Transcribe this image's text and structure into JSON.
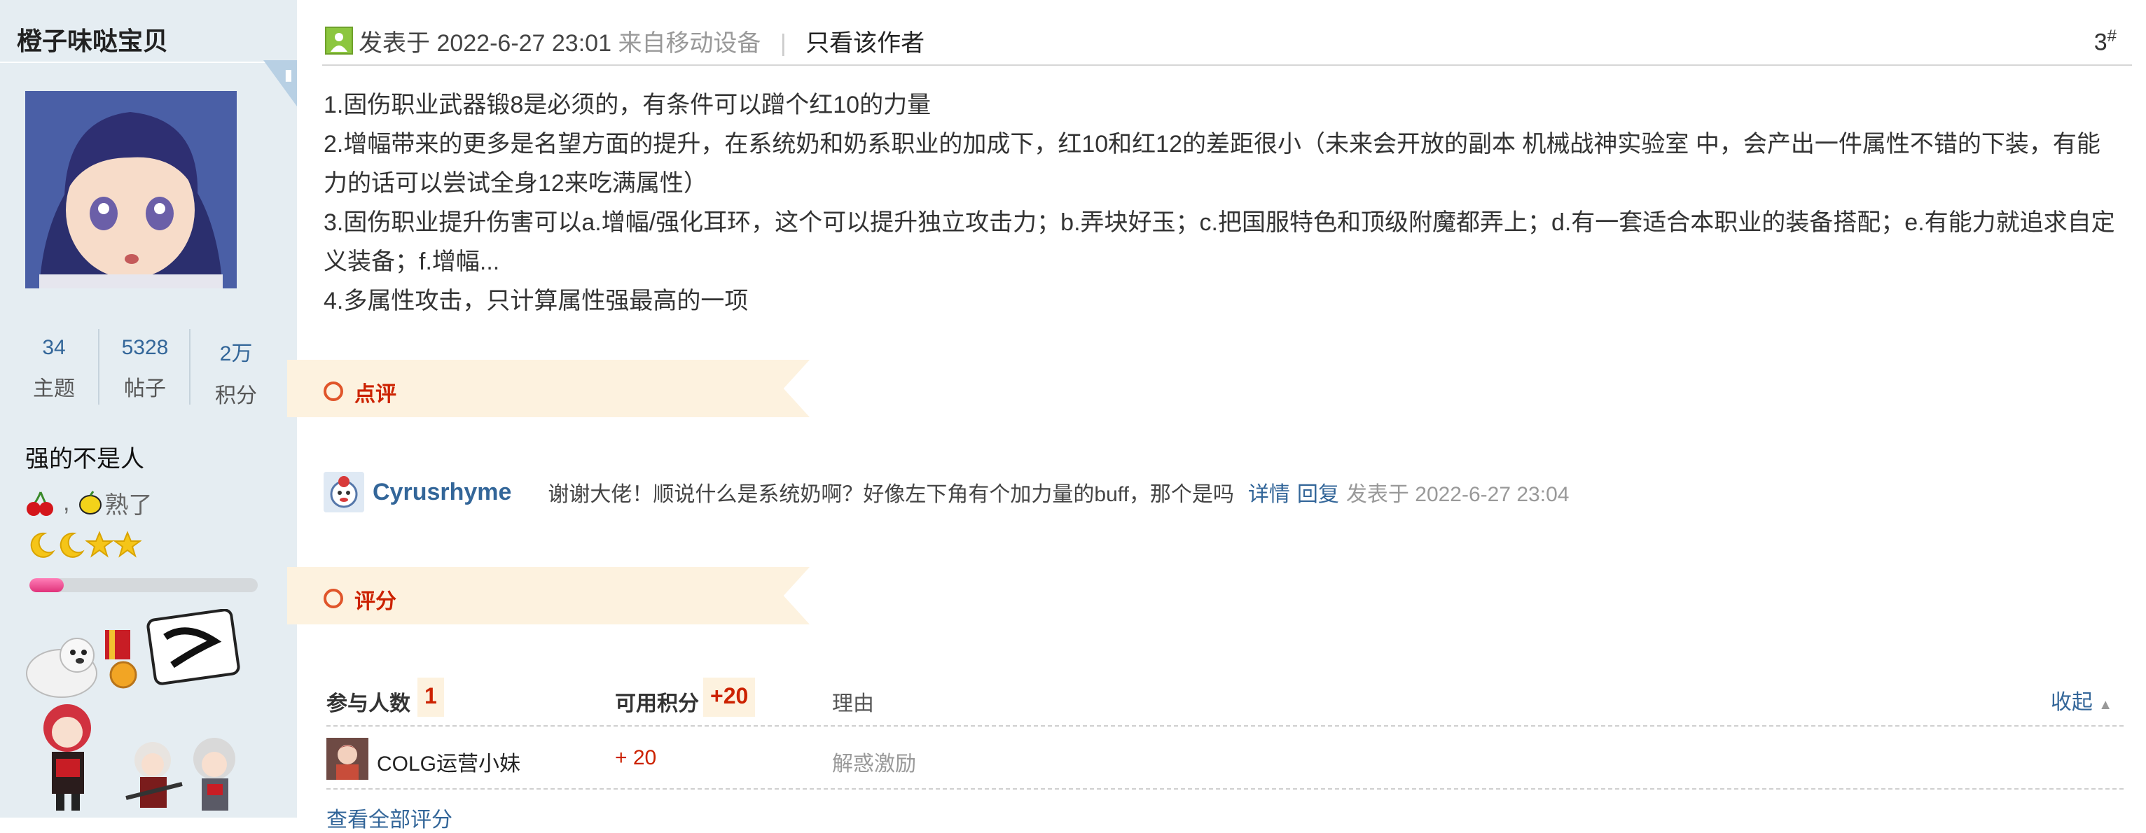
{
  "author": {
    "name": "橙子味哒宝贝",
    "stats": [
      {
        "value": "34",
        "label": "主题"
      },
      {
        "value": "5328",
        "label": "帖子"
      },
      {
        "value": "2万",
        "label": "积分"
      }
    ],
    "title": "强的不是人",
    "medal_text": "熟了",
    "level_progress": 0.15
  },
  "post": {
    "posted_label": "发表于 2022-6-27 23:01",
    "device_label": "来自移动设备",
    "separator": "|",
    "only_author_label": "只看该作者",
    "floor_number": "3",
    "floor_mark": "#",
    "lines": [
      "1.固伤职业武器锻8是必须的，有条件可以蹭个红10的力量",
      "2.增幅带来的更多是名望方面的提升，在系统奶和奶系职业的加成下，红10和红12的差距很小（未来会开放的副本 机械战神实验室 中，会产出一件属性不错的下装，有能力的话可以尝试全身12来吃满属性）",
      "3.固伤职业提升伤害可以a.增幅/强化耳环，这个可以提升独立攻击力；b.弄块好玉；c.把国服特色和顶级附魔都弄上；d.有一套适合本职业的装备搭配；e.有能力就追求自定义装备；f.增幅...",
      "4.多属性攻击，只计算属性强最高的一项"
    ]
  },
  "comments_section": {
    "label": "点评",
    "items": [
      {
        "user": "Cyrusrhyme",
        "text": "谢谢大佬！顺说什么是系统奶啊？好像左下角有个加力量的buff，那个是吗",
        "detail_link": "详情",
        "reply_link": "回复",
        "time": "发表于 2022-6-27 23:04"
      }
    ]
  },
  "rating_section": {
    "label": "评分",
    "participants_label": "参与人数",
    "participants_count": "1",
    "points_label": "可用积分",
    "points_total": "+20",
    "reason_header": "理由",
    "collapse_label": "收起",
    "rows": [
      {
        "user": "COLG运营小妹",
        "score": "+ 20",
        "reason": "解惑激励"
      }
    ],
    "view_all_label": "查看全部评分"
  },
  "colors": {
    "sidebar_bg": "#e5edf2",
    "link_blue": "#336699",
    "accent_red": "#cc2200",
    "tab_bg": "#fdf2df",
    "progress_pink": "#e0337a"
  },
  "icons": [
    "phone-icon",
    "post-status-icon",
    "cherry-icon",
    "lemon-icon",
    "moon-icon",
    "star-icon",
    "ring-icon",
    "caret-up-icon"
  ]
}
